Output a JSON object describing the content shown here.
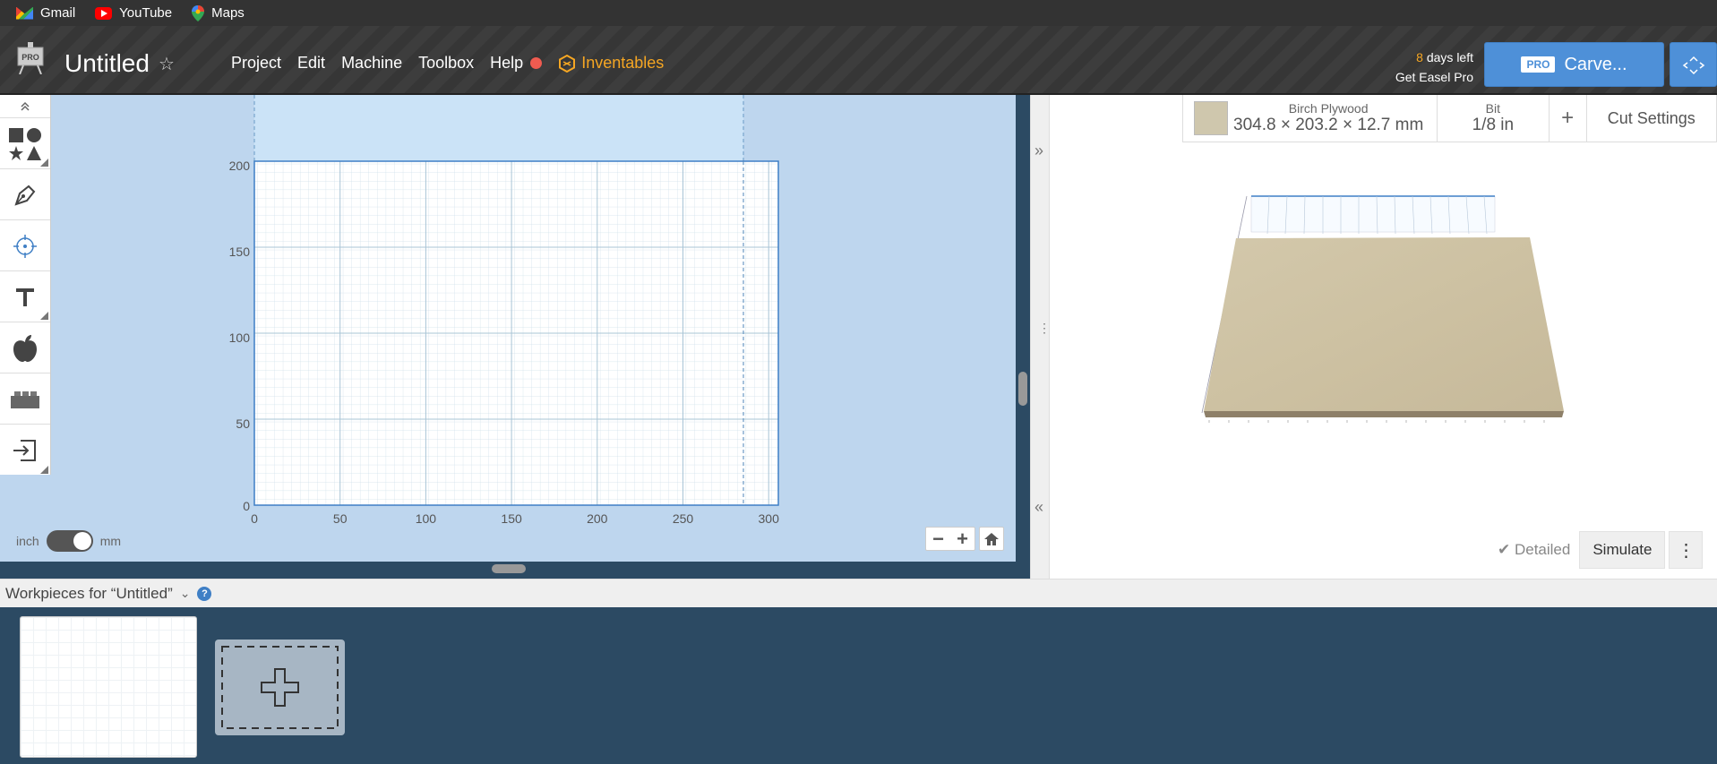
{
  "bookmarks": [
    {
      "label": "Gmail",
      "icon": "gmail-icon"
    },
    {
      "label": "YouTube",
      "icon": "youtube-icon"
    },
    {
      "label": "Maps",
      "icon": "maps-icon"
    }
  ],
  "header": {
    "title": "Untitled",
    "logo_badge": "PRO",
    "menu": [
      "Project",
      "Edit",
      "Machine",
      "Toolbox",
      "Help"
    ],
    "inventables": "Inventables",
    "trial_days": "8",
    "trial_text": "days left",
    "get_pro": "Get Easel Pro",
    "carve_badge": "PRO",
    "carve_label": "Carve..."
  },
  "canvas": {
    "y_ticks": [
      "200",
      "150",
      "100",
      "50",
      "0"
    ],
    "x_ticks": [
      "0",
      "50",
      "100",
      "150",
      "200",
      "250",
      "300"
    ],
    "unit_left": "inch",
    "unit_right": "mm"
  },
  "material": {
    "name": "Birch Plywood",
    "dimensions": "304.8 × 203.2 × 12.7 mm",
    "bit_label": "Bit",
    "bit_value": "1/8 in",
    "add_symbol": "+",
    "cut_settings": "Cut Settings"
  },
  "preview": {
    "detailed": "Detailed",
    "simulate": "Simulate"
  },
  "workpieces": {
    "title": "Workpieces for “Untitled”",
    "help": "?"
  },
  "colors": {
    "accent": "#4e90d8",
    "inventables": "#f5a623",
    "canvas_bg": "#bed6ee",
    "workpiece_bg": "#2c4a63"
  }
}
